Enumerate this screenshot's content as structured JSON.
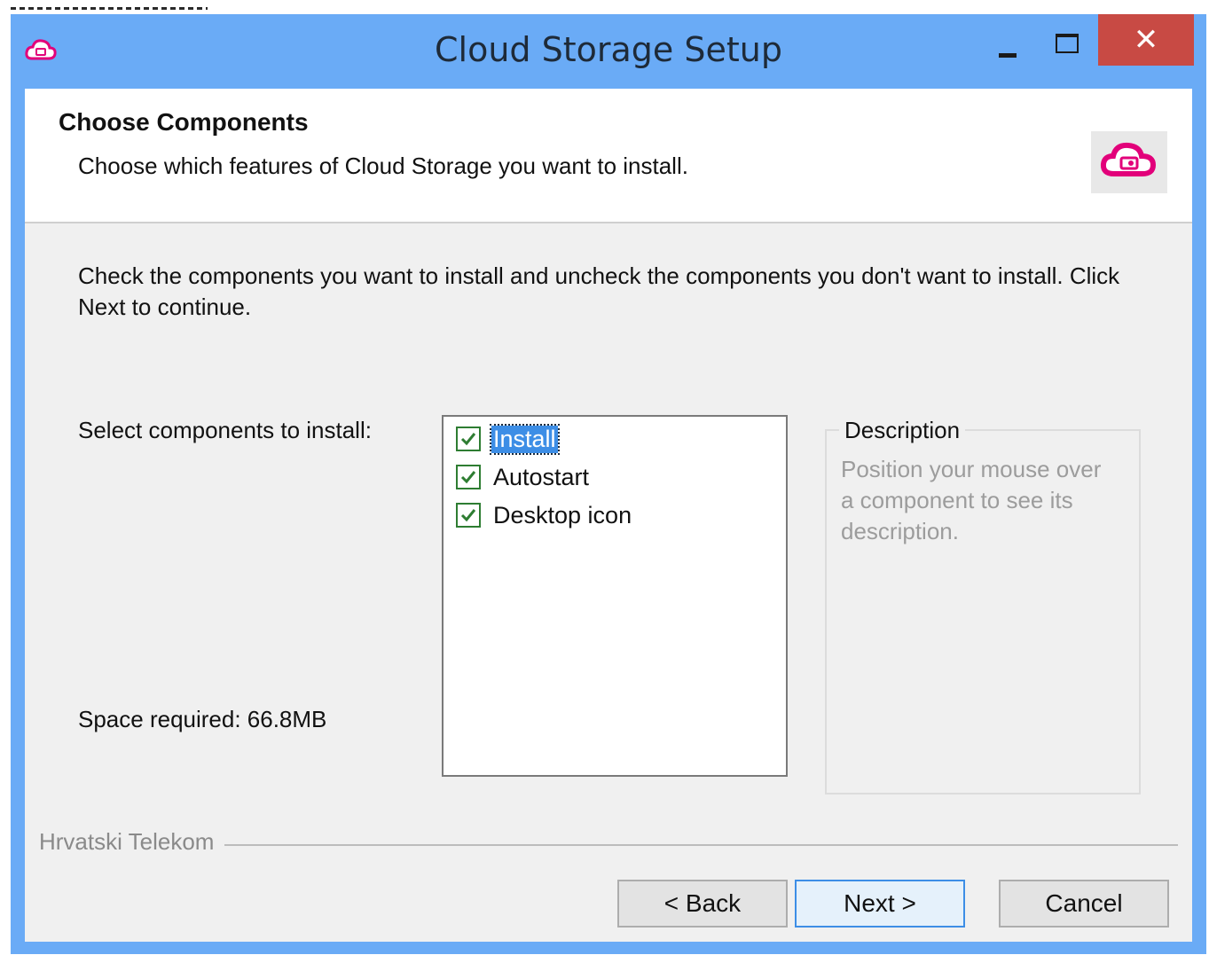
{
  "window": {
    "title": "Cloud Storage Setup",
    "close_glyph": "✕",
    "accent_color": "#6aabf6",
    "brand_color": "#e2007a"
  },
  "header": {
    "title": "Choose Components",
    "subtitle": "Choose which features of Cloud Storage you want to install."
  },
  "body": {
    "intro": "Check the components you want to install and uncheck the components you don't want to install. Click Next to continue.",
    "select_label": "Select components to install:",
    "space_required": "Space required: 66.8MB",
    "components": [
      {
        "label": "Install",
        "checked": true,
        "selected": true
      },
      {
        "label": "Autostart",
        "checked": true,
        "selected": false
      },
      {
        "label": "Desktop icon",
        "checked": true,
        "selected": false
      }
    ],
    "description": {
      "title": "Description",
      "text": "Position your mouse over a component to see its description."
    }
  },
  "footer": {
    "brand": "Hrvatski Telekom",
    "back_label": "< Back",
    "next_label": "Next >",
    "cancel_label": "Cancel"
  }
}
